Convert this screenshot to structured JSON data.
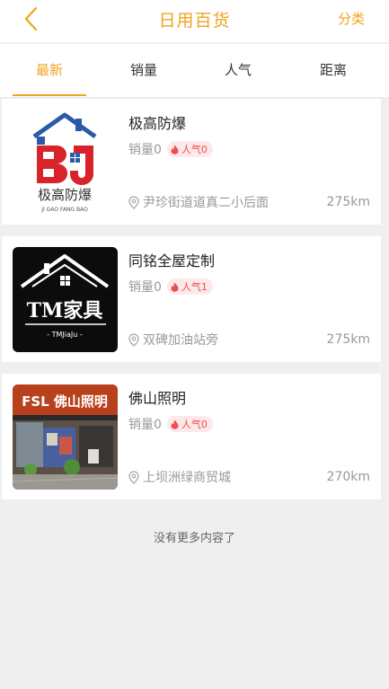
{
  "colors": {
    "accent": "#f0a31e",
    "badge_text": "#ee4d4d",
    "badge_bg": "#fde9e9"
  },
  "header": {
    "back_icon": "chevron-left-icon",
    "title": "日用百货",
    "action_label": "分类"
  },
  "tabs": [
    {
      "label": "最新",
      "active": true
    },
    {
      "label": "销量",
      "active": false
    },
    {
      "label": "人气",
      "active": false
    },
    {
      "label": "距离",
      "active": false
    }
  ],
  "stores": [
    {
      "name": "极高防爆",
      "sales": "销量0",
      "popularity": "人气0",
      "address": "尹珍街道道真二小后面",
      "distance": "275km",
      "logo": {
        "name_text": "极高防爆",
        "sub_text": "JI GAO FANG BAO"
      }
    },
    {
      "name": "同铭全屋定制",
      "sales": "销量0",
      "popularity": "人气1",
      "address": "双碑加油站旁",
      "distance": "275km",
      "logo": {
        "main_text": "TM家具",
        "sub_text": "- TMJiaJu -"
      }
    },
    {
      "name": "佛山照明",
      "sales": "销量0",
      "popularity": "人气0",
      "address": "上坝洲绿商贸城",
      "distance": "270km",
      "logo": {
        "sign_text": "FSL 佛山照明"
      }
    }
  ],
  "footer_note": "没有更多内容了"
}
